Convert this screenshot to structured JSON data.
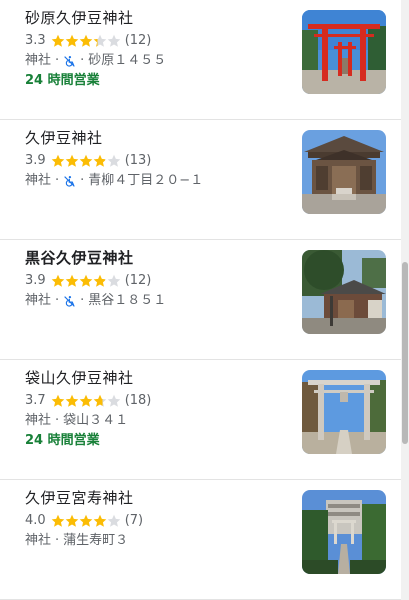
{
  "results": [
    {
      "name": "砂原久伊豆神社",
      "rating": "3.3",
      "rating_value": 3.3,
      "reviews": "(12)",
      "category": "神社",
      "accessibility_icon": "no-wheelchair-icon",
      "address": "砂原１４５５",
      "hours": "24 時間営業"
    },
    {
      "name": "久伊豆神社",
      "rating": "3.9",
      "rating_value": 3.9,
      "reviews": "(13)",
      "category": "神社",
      "accessibility_icon": "no-wheelchair-icon",
      "address": "青柳４丁目２０−１",
      "hours": ""
    },
    {
      "name": "黒谷久伊豆神社",
      "rating": "3.9",
      "rating_value": 3.9,
      "reviews": "(12)",
      "category": "神社",
      "accessibility_icon": "no-wheelchair-icon",
      "address": "黒谷１８５１",
      "hours": ""
    },
    {
      "name": "袋山久伊豆神社",
      "rating": "3.7",
      "rating_value": 3.7,
      "reviews": "(18)",
      "category": "神社",
      "accessibility_icon": "",
      "address": "袋山３４１",
      "hours": "24 時間営業"
    },
    {
      "name": "久伊豆宮寿神社",
      "rating": "4.0",
      "rating_value": 4.0,
      "reviews": "(7)",
      "category": "神社",
      "accessibility_icon": "",
      "address": "蒲生寿町３",
      "hours": ""
    }
  ],
  "separator": "·",
  "colors": {
    "star_filled": "#fbbc04",
    "star_empty": "#dadce0",
    "open_hours": "#188038",
    "accessibility_icon": "#1a73e8",
    "text_secondary": "#5f6368"
  }
}
